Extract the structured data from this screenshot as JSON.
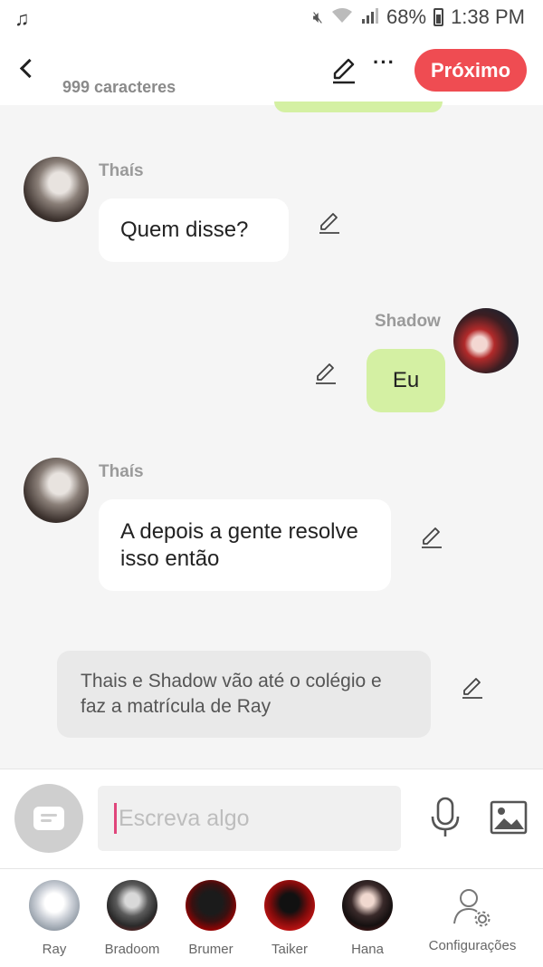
{
  "status_bar": {
    "music_icon": "music-note-icon",
    "battery": "68%",
    "time": "1:38 PM"
  },
  "header": {
    "char_count": "999 caracteres",
    "next_label": "Próximo"
  },
  "messages": [
    {
      "sender": "Thaís",
      "text": "Quem disse?",
      "side": "left"
    },
    {
      "sender": "Shadow",
      "text": "Eu",
      "side": "right"
    },
    {
      "sender": "Thaís",
      "text": "A depois a gente resolve isso então",
      "side": "left"
    }
  ],
  "narration": "Thais e Shadow vão até o colégio e faz a matrícula de Ray",
  "composer": {
    "placeholder": "Escreva algo"
  },
  "tabs": [
    {
      "label": "Ray"
    },
    {
      "label": "Bradoom"
    },
    {
      "label": "Brumer"
    },
    {
      "label": "Taiker"
    },
    {
      "label": "Hana"
    },
    {
      "label": "Configurações"
    }
  ],
  "colors": {
    "accent": "#ef4c52",
    "bubble_green": "#d4f0a3",
    "cursor": "#e0457b"
  }
}
